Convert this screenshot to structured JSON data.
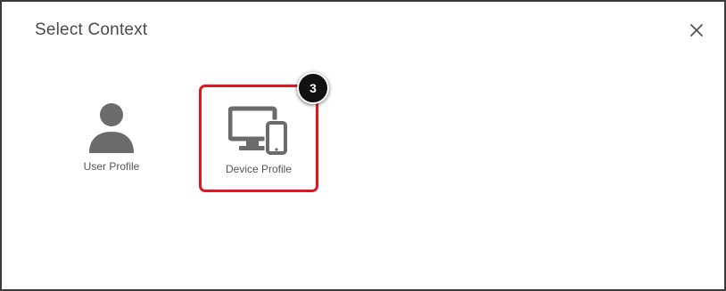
{
  "dialog": {
    "title": "Select Context",
    "close_icon": "close-icon"
  },
  "options": [
    {
      "label": "User Profile",
      "icon": "user-icon"
    },
    {
      "label": "Device Profile",
      "icon": "devices-icon"
    }
  ],
  "annotation": {
    "step_number": "3",
    "highlight_color": "#e3161f"
  }
}
